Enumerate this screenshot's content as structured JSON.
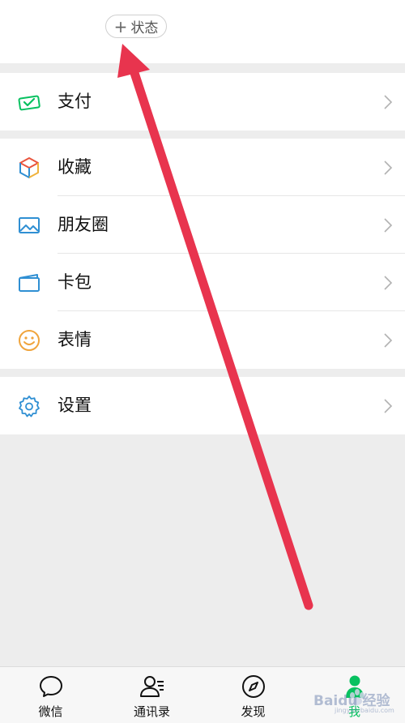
{
  "header": {
    "status_button": {
      "icon": "plus-icon",
      "label": "状态"
    }
  },
  "groups": [
    {
      "items": [
        {
          "label": "支付",
          "icon": "wechat-pay-icon",
          "color": "#07c160"
        }
      ]
    },
    {
      "items": [
        {
          "label": "收藏",
          "icon": "favorites-cube-icon",
          "color": "#e9543d"
        },
        {
          "label": "朋友圈",
          "icon": "moments-picture-icon",
          "color": "#2f8fd3"
        },
        {
          "label": "卡包",
          "icon": "card-wallet-icon",
          "color": "#2f8fd3"
        },
        {
          "label": "表情",
          "icon": "smiley-sticker-icon",
          "color": "#f0a43c"
        }
      ]
    },
    {
      "items": [
        {
          "label": "设置",
          "icon": "gear-settings-icon",
          "color": "#2f8fd3"
        }
      ]
    }
  ],
  "tabbar": {
    "tabs": [
      {
        "label": "微信",
        "icon": "chat-bubble-icon",
        "active": false
      },
      {
        "label": "通讯录",
        "icon": "contacts-icon",
        "active": false
      },
      {
        "label": "发现",
        "icon": "compass-icon",
        "active": false
      },
      {
        "label": "我",
        "icon": "person-icon",
        "active": true
      }
    ]
  },
  "annotation": {
    "arrow_color": "#e8344e"
  },
  "watermark": {
    "text": "Baidu 经验",
    "subtext": "jingyan.baidu.com"
  },
  "colors": {
    "accent": "#07c160",
    "background": "#ededed",
    "surface": "#ffffff"
  }
}
